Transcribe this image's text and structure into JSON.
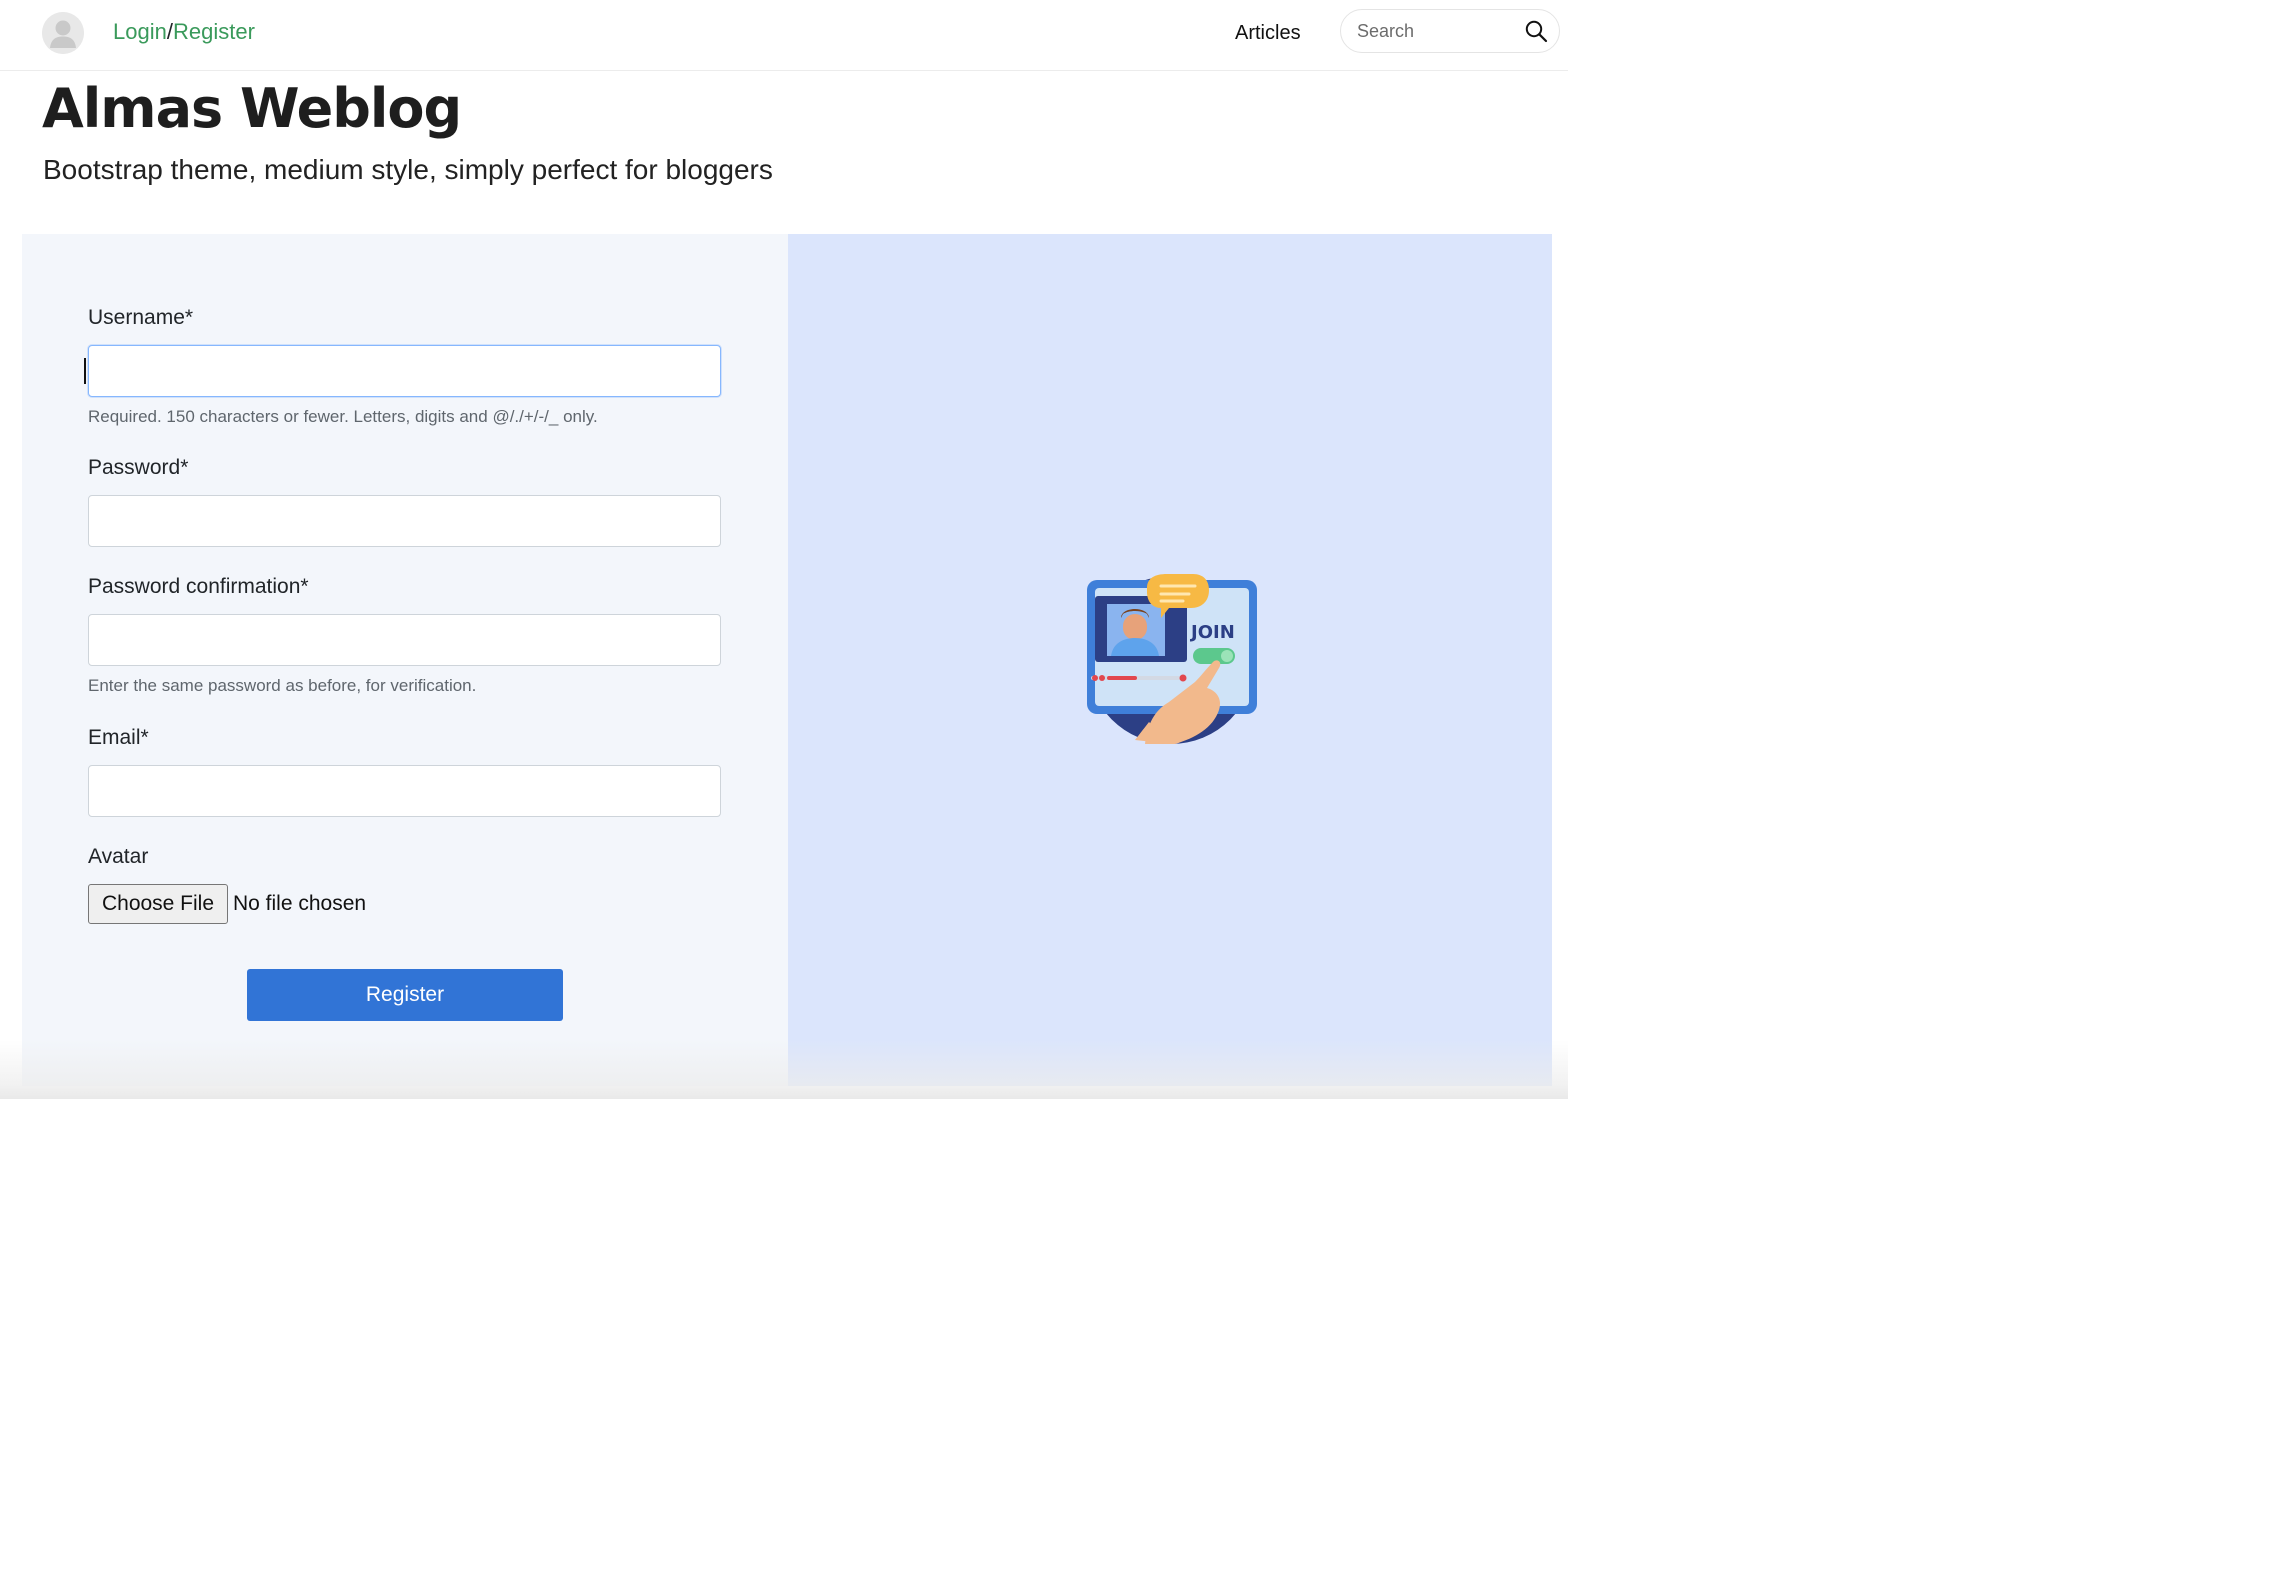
{
  "navbar": {
    "login_label": "Login",
    "separator": "/",
    "register_label": "Register",
    "articles_label": "Articles",
    "search_placeholder": "Search"
  },
  "header": {
    "title": "Almas Weblog",
    "tagline": "Bootstrap theme, medium style, simply perfect for bloggers"
  },
  "form": {
    "username": {
      "label": "Username*",
      "value": "",
      "help": "Required. 150 characters or fewer. Letters, digits and @/./+/-/_ only."
    },
    "password": {
      "label": "Password*",
      "value": ""
    },
    "password_confirmation": {
      "label": "Password confirmation*",
      "value": "",
      "help": "Enter the same password as before, for verification."
    },
    "email": {
      "label": "Email*",
      "value": ""
    },
    "avatar": {
      "label": "Avatar",
      "button_label": "Choose File",
      "status": "No file chosen"
    },
    "submit_label": "Register"
  },
  "illustration": {
    "join_text": "JOIN"
  },
  "colors": {
    "link_green": "#3a9a5b",
    "primary_blue": "#3174d6",
    "form_panel_bg": "#f3f6fb",
    "illustration_panel_bg": "#dbe5fc"
  },
  "icons": [
    "user-avatar-icon",
    "search-icon"
  ]
}
